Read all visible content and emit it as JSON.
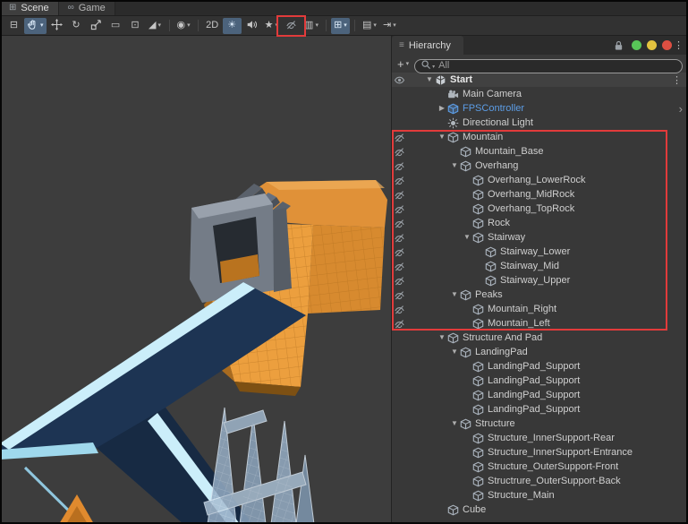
{
  "view_tabs": [
    {
      "label": "Scene",
      "icon_glyph": "⊞",
      "active": true
    },
    {
      "label": "Game",
      "icon_glyph": "∞",
      "active": false
    }
  ],
  "glyphs": {
    "dropdown": "▾",
    "fold_open": "▼",
    "fold_closed": "▶",
    "kebab": "⋮",
    "chevron": "›",
    "menu": "≡"
  },
  "toolbar": {
    "items": [
      {
        "name": "tool-settings-button",
        "glyph": "⊟"
      },
      {
        "name": "hand-tool-button",
        "icon": "hand",
        "selected": true,
        "dropdown": true
      },
      {
        "name": "move-tool-button",
        "icon": "move"
      },
      {
        "name": "rotate-tool-button",
        "glyph": "↻"
      },
      {
        "name": "scale-tool-button",
        "icon": "scale"
      },
      {
        "name": "rect-tool-button",
        "glyph": "▭"
      },
      {
        "name": "transform-tool-button",
        "glyph": "⊡"
      },
      {
        "name": "custom-tool-button",
        "glyph": "◢",
        "dropdown": true
      },
      {
        "separator": true
      },
      {
        "name": "pivot-toggle-button",
        "glyph": "◉",
        "dropdown": true
      },
      {
        "separator": true
      },
      {
        "name": "2d-toggle-button",
        "glyph": "2D"
      },
      {
        "name": "lighting-toggle-button",
        "glyph": "☀",
        "selected": true
      },
      {
        "name": "audio-toggle-button",
        "icon": "speaker"
      },
      {
        "name": "effects-toggle-button",
        "glyph": "★",
        "dropdown": true
      },
      {
        "name": "hidden-objects-toggle-button",
        "icon": "eye-off",
        "annotated": true
      },
      {
        "name": "overlays-menu-button",
        "glyph": "▥",
        "dropdown": true
      },
      {
        "separator": true
      },
      {
        "name": "grid-toggle-button",
        "glyph": "⊞",
        "selected": true,
        "dropdown": true
      },
      {
        "separator": true
      },
      {
        "name": "snap-settings-button",
        "glyph": "▤",
        "dropdown": true
      },
      {
        "name": "step-button",
        "glyph": "⇥",
        "dropdown": true
      }
    ]
  },
  "hierarchy": {
    "tab_label": "Hierarchy",
    "add_label": "+",
    "search": {
      "placeholder": "All"
    },
    "root": {
      "label": "Start"
    },
    "items": [
      {
        "label": "Main Camera",
        "depth": 1,
        "icon": "camera"
      },
      {
        "label": "FPSController",
        "depth": 1,
        "icon": "prefab",
        "prefab": true,
        "fold": "closed",
        "chevron": true
      },
      {
        "label": "Directional Light",
        "depth": 1,
        "icon": "light"
      },
      {
        "label": "Mountain",
        "depth": 1,
        "icon": "cube",
        "fold": "open",
        "hidden": true
      },
      {
        "label": "Mountain_Base",
        "depth": 2,
        "icon": "cube",
        "hidden": true
      },
      {
        "label": "Overhang",
        "depth": 2,
        "icon": "cube",
        "fold": "open",
        "hidden": true
      },
      {
        "label": "Overhang_LowerRock",
        "depth": 3,
        "icon": "cube",
        "hidden": true
      },
      {
        "label": "Overhang_MidRock",
        "depth": 3,
        "icon": "cube",
        "hidden": true
      },
      {
        "label": "Overhang_TopRock",
        "depth": 3,
        "icon": "cube",
        "hidden": true
      },
      {
        "label": "Rock",
        "depth": 3,
        "icon": "cube",
        "hidden": true
      },
      {
        "label": "Stairway",
        "depth": 3,
        "icon": "cube",
        "fold": "open",
        "hidden": true
      },
      {
        "label": "Stairway_Lower",
        "depth": 4,
        "icon": "cube",
        "hidden": true
      },
      {
        "label": "Stairway_Mid",
        "depth": 4,
        "icon": "cube",
        "hidden": true
      },
      {
        "label": "Stairway_Upper",
        "depth": 4,
        "icon": "cube",
        "hidden": true
      },
      {
        "label": "Peaks",
        "depth": 2,
        "icon": "cube",
        "fold": "open",
        "hidden": true
      },
      {
        "label": "Mountain_Right",
        "depth": 3,
        "icon": "cube",
        "hidden": true
      },
      {
        "label": "Mountain_Left",
        "depth": 3,
        "icon": "cube",
        "hidden": true
      },
      {
        "label": "Structure And Pad",
        "depth": 1,
        "icon": "cube",
        "fold": "open"
      },
      {
        "label": "LandingPad",
        "depth": 2,
        "icon": "cube",
        "fold": "open"
      },
      {
        "label": "LandingPad_Support",
        "depth": 3,
        "icon": "cube"
      },
      {
        "label": "LandingPad_Support",
        "depth": 3,
        "icon": "cube"
      },
      {
        "label": "LandingPad_Support",
        "depth": 3,
        "icon": "cube"
      },
      {
        "label": "LandingPad_Support",
        "depth": 3,
        "icon": "cube"
      },
      {
        "label": "Structure",
        "depth": 2,
        "icon": "cube",
        "fold": "open"
      },
      {
        "label": "Structure_InnerSupport-Rear",
        "depth": 3,
        "icon": "cube"
      },
      {
        "label": "Structure_InnerSupport-Entrance",
        "depth": 3,
        "icon": "cube"
      },
      {
        "label": "Structure_OuterSupport-Front",
        "depth": 3,
        "icon": "cube"
      },
      {
        "label": "Structrure_OuterSupport-Back",
        "depth": 3,
        "icon": "cube"
      },
      {
        "label": "Structure_Main",
        "depth": 3,
        "icon": "cube"
      },
      {
        "label": "Cube",
        "depth": 1,
        "icon": "cube"
      }
    ]
  },
  "colors": {
    "annotation_red": "#E23B3B",
    "prefab_text": "#5C9DE6",
    "selected_tool_bg": "#4C637C",
    "dot_green": "#58C558",
    "dot_yellow": "#E3C23F",
    "dot_red": "#DD4F42"
  }
}
